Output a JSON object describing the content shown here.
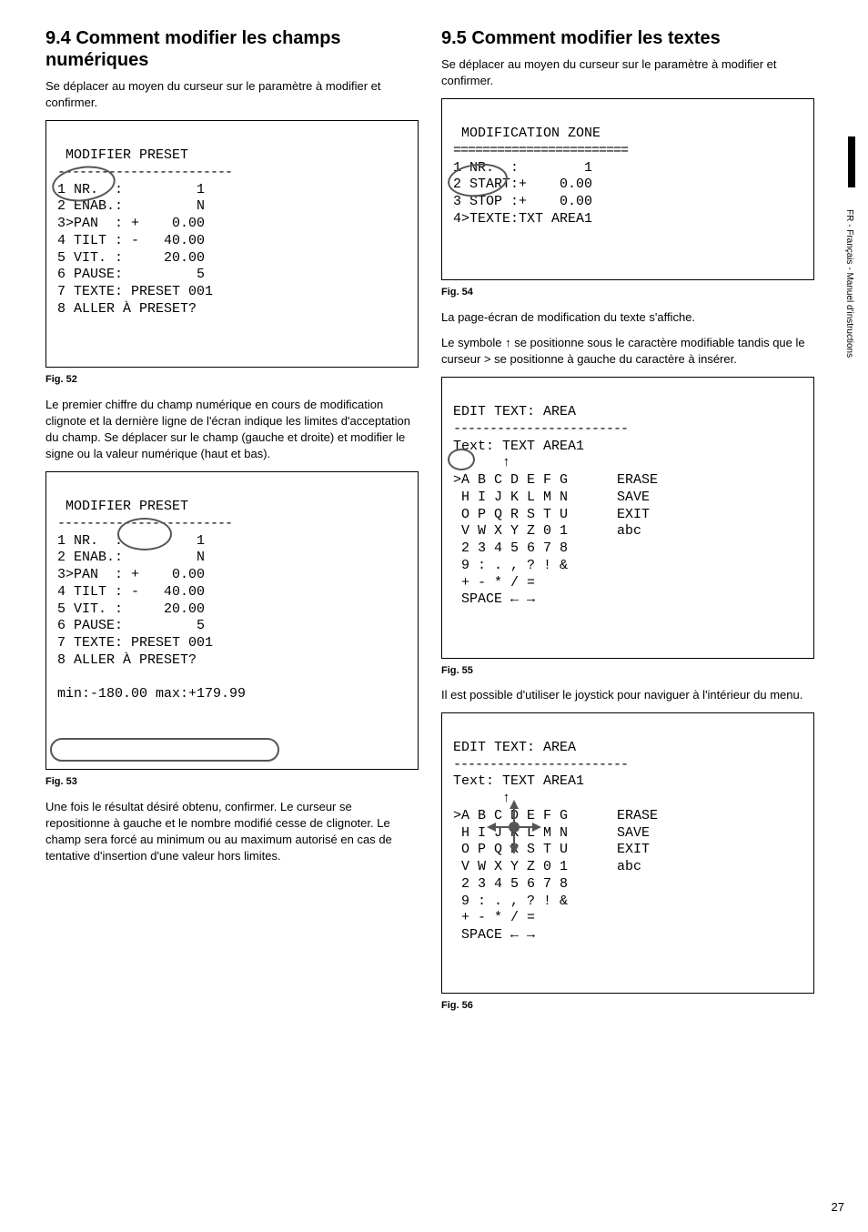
{
  "sidebar_text": "FR - Français - Manuel d'instructions",
  "page_number": "27",
  "left": {
    "h2": "9.4 Comment modifier les champs numériques",
    "p1": "Se déplacer au moyen du curseur sur le paramètre à modifier et confirmer.",
    "fig52": {
      "title": " MODIFIER PRESET",
      "dashes": "------------------------",
      "l1": "1 NR.  :         1",
      "l2": "2 ENAB.:         N",
      "l3": "3>PAN  : +    0.00",
      "l4": "4 TILT : -   40.00",
      "l5": "5 VIT. :     20.00",
      "l6": "6 PAUSE:         5",
      "l7": "7 TEXTE: PRESET 001",
      "l8": "8 ALLER À PRESET?",
      "caption": "Fig. 52"
    },
    "p2": "Le premier chiffre du champ numérique en cours de modification clignote et la dernière ligne de l'écran indique les limites d'acceptation du champ. Se déplacer sur le champ (gauche et droite) et modifier le signe ou la valeur numérique (haut et bas).",
    "fig53": {
      "title": " MODIFIER PRESET",
      "dashes": "------------------------",
      "l1": "1 NR.  :         1",
      "l2": "2 ENAB.:         N",
      "l3": "3>PAN  : +    0.00",
      "l4": "4 TILT : -   40.00",
      "l5": "5 VIT. :     20.00",
      "l6": "6 PAUSE:         5",
      "l7": "7 TEXTE: PRESET 001",
      "l8": "8 ALLER À PRESET?",
      "minmax": "min:-180.00 max:+179.99",
      "caption": "Fig. 53"
    },
    "p3": "Une fois le résultat désiré obtenu, confirmer. Le curseur se repositionne à gauche et le nombre modifié cesse de clignoter. Le champ sera forcé au minimum ou au maximum autorisé en cas de tentative d'insertion d'une valeur hors limites."
  },
  "right": {
    "h2": "9.5 Comment modifier les textes",
    "p1": "Se déplacer au moyen du curseur sur le paramètre à modifier et confirmer.",
    "fig54": {
      "title": " MODIFICATION ZONE",
      "dashes": "========================",
      "l1": "1 NR.  :        1",
      "l2": "2 START:+    0.00",
      "l3": "3 STOP :+    0.00",
      "l4": "4>TEXTE:TXT AREA1",
      "caption": "Fig. 54"
    },
    "p2": "La page-écran de modification du texte s'affiche.",
    "p3": "Le symbole ↑ se positionne sous le caractère modifiable tandis que le curseur > se positionne à gauche du caractère à insérer.",
    "fig55": {
      "title": "EDIT TEXT: AREA",
      "dashes": "------------------------",
      "l1": "Text: TEXT AREA1",
      "arrow": "      ↑",
      "l2": ">A B C D E F G      ERASE",
      "l3": " H I J K L M N      SAVE",
      "l4": " O P Q R S T U      EXIT",
      "l5": " V W X Y Z 0 1      abc",
      "l6": " 2 3 4 5 6 7 8",
      "l7": " 9 : . , ? ! &",
      "l8": " + - * / =",
      "l9": " SPACE ← →",
      "caption": "Fig. 55"
    },
    "p4": "Il est possible d'utiliser le joystick pour naviguer à l'intérieur du menu.",
    "fig56": {
      "title": "EDIT TEXT: AREA",
      "dashes": "------------------------",
      "l1": "Text: TEXT AREA1",
      "arrow": "      ↑",
      "l2": ">A B C D E F G      ERASE",
      "l3": " H I J K L M N      SAVE",
      "l4": " O P Q R S T U      EXIT",
      "l5": " V W X Y Z 0 1      abc",
      "l6": " 2 3 4 5 6 7 8",
      "l7": " 9 : . , ? ! &",
      "l8": " + - * / =",
      "l9": " SPACE ← →",
      "caption": "Fig. 56"
    }
  }
}
